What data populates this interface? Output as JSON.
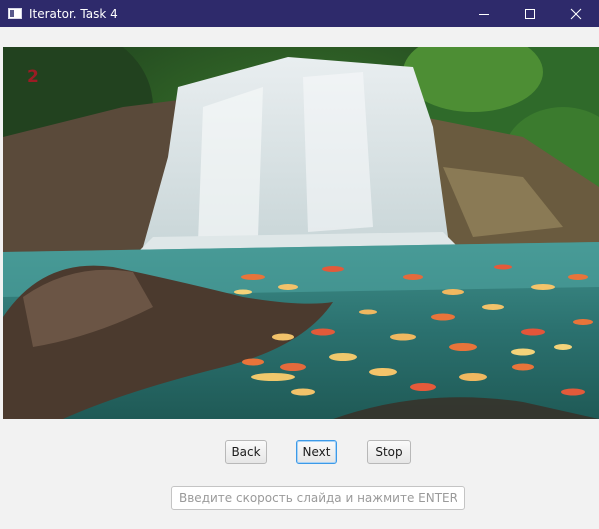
{
  "window": {
    "title": "Iterator. Task 4",
    "controls": {
      "minimize": "minimize-icon",
      "maximize": "maximize-icon",
      "close": "close-icon"
    }
  },
  "slide": {
    "number": "2",
    "image_icon": "waterfall-koi-photo"
  },
  "buttons": {
    "back": "Back",
    "next": "Next",
    "stop": "Stop"
  },
  "speed_field": {
    "value": "",
    "placeholder": "Введите скорость слайда и нажмите ENTER"
  },
  "colors": {
    "titlebar": "#2e2a6b",
    "focus": "#3c9ae8",
    "slide_number": "#9b1c24"
  }
}
